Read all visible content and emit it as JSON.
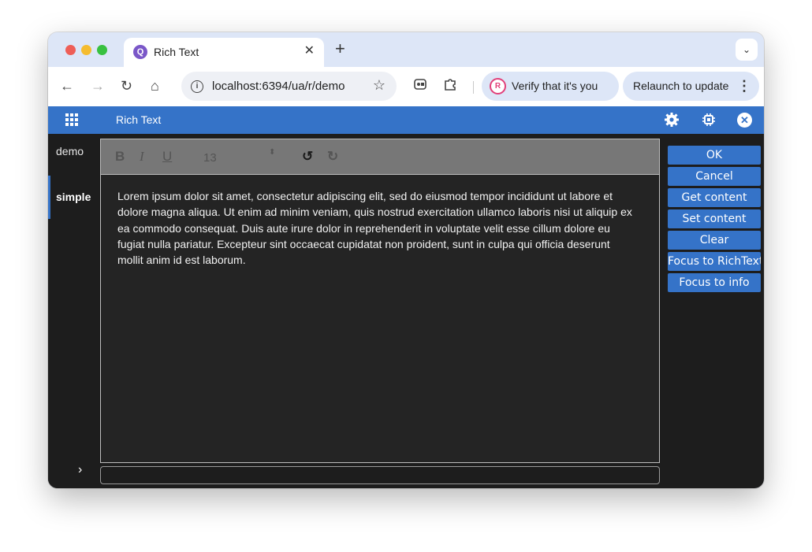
{
  "browser": {
    "tab": {
      "title": "Rich Text",
      "favicon": "Q",
      "close": "✕"
    },
    "new_tab": "+",
    "tab_menu": "⌄",
    "toolbar": {
      "back": "←",
      "forward": "→",
      "reload": "↻",
      "home": "⌂",
      "address": "localhost:6394/ua/r/demo",
      "info": "i",
      "star": "☆",
      "verify_label": "Verify that it's you",
      "verify_avatar": "R",
      "relaunch_label": "Relaunch to update",
      "kebab": "⋮"
    }
  },
  "app": {
    "title": "Rich Text",
    "sidebar": {
      "items": [
        {
          "label": "demo"
        },
        {
          "label": "simple"
        }
      ],
      "expand": "›"
    },
    "editor": {
      "toolbar": {
        "bold": "B",
        "italic": "I",
        "underline": "U",
        "font_size": "13",
        "font_size_arrows": "⬍",
        "undo": "↺",
        "redo": "↻"
      },
      "content": "Lorem ipsum dolor sit amet, consectetur adipiscing elit, sed do eiusmod tempor incididunt ut labore et dolore magna aliqua. Ut enim ad minim veniam, quis nostrud exercitation ullamco laboris nisi ut aliquip ex ea commodo consequat. Duis aute irure dolor in reprehenderit in voluptate velit esse cillum dolore eu fugiat nulla pariatur. Excepteur sint occaecat cupidatat non proident, sunt in culpa qui officia deserunt mollit anim id est laborum."
    },
    "info_value": "",
    "actions": {
      "ok": "OK",
      "cancel": "Cancel",
      "get_content": "Get content",
      "set_content": "Set content",
      "clear": "Clear",
      "focus_richtext": "Focus to RichText",
      "focus_info": "Focus to info"
    },
    "colors": {
      "accent": "#3573c8",
      "background": "#1d1d1d",
      "editor_toolbar": "#777777"
    }
  }
}
